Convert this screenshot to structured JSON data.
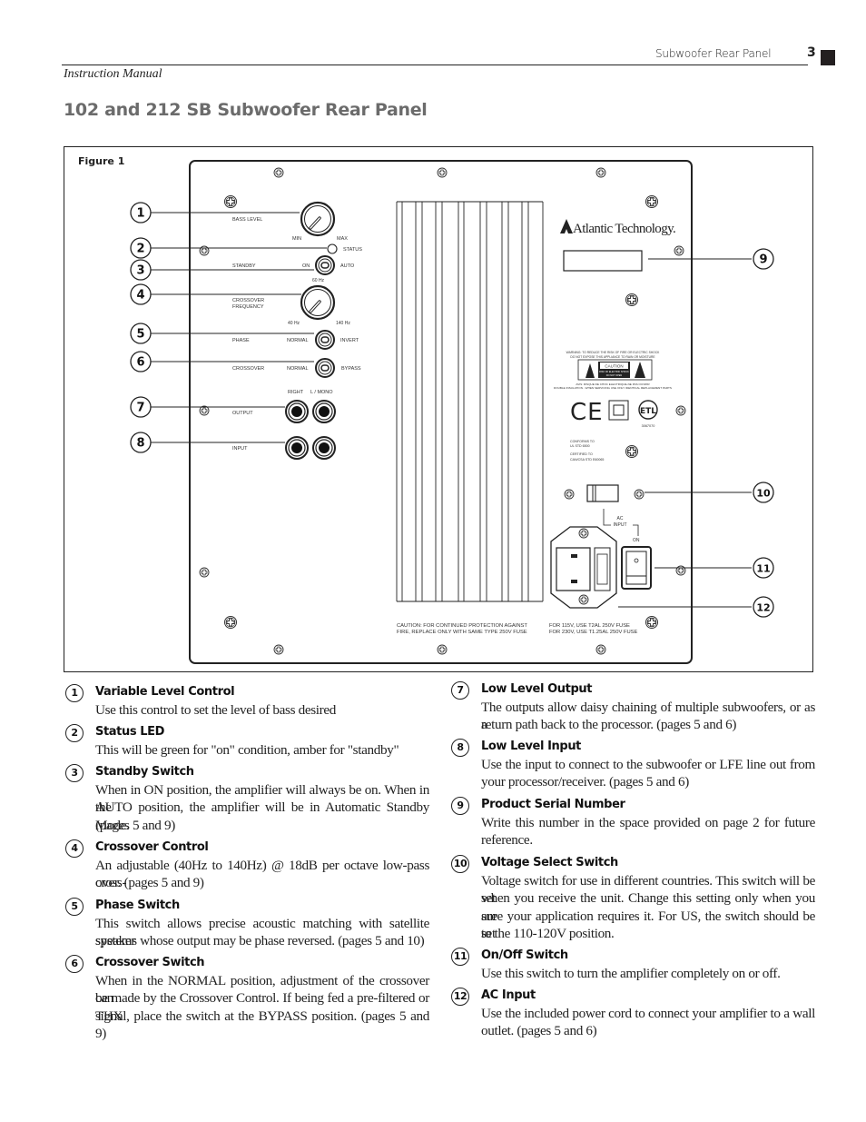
{
  "header": {
    "running_title": "Subwoofer Rear Panel",
    "page_number": "3",
    "manual_label": "Instruction Manual"
  },
  "page_title": "102 and 212 SB Subwoofer Rear Panel",
  "figure": {
    "label": "Figure 1",
    "brand": "Atlantic Technology.",
    "controls": {
      "bass_level": "BASS LEVEL",
      "min": "MIN",
      "max": "MAX",
      "status": "STATUS",
      "standby": "STANDBY",
      "on": "ON",
      "auto": "AUTO",
      "freq_60": "60 Hz",
      "crossover_frequency_1": "CROSSOVER",
      "crossover_frequency_2": "FREQUENCY",
      "freq_40": "40 Hz",
      "freq_140": "140 Hz",
      "phase": "PHASE",
      "normal": "NORMAL",
      "invert": "INVERT",
      "crossover": "CROSSOVER",
      "bypass": "BYPASS",
      "right": "RIGHT",
      "l_mono": "L / MONO",
      "output": "OUTPUT",
      "input": "INPUT"
    },
    "warning": {
      "line1": "WARNING: TO REDUCE THE RISK OF FIRE OR ELECTRIC SHOCK",
      "line2": "DO NOT EXPOSE THIS APPLIANCE TO RAIN OR MOISTURE",
      "caution": "CAUTION",
      "caution_sub1": "RISK OF ELECTRIC SHOCK",
      "caution_sub2": "DO NOT OPEN",
      "line3": "AVIS: RISQUE DE CHOC ELECTRIQUE-NE PAS OUVRIR",
      "line4": "DOUBLE INSULATION - WHEN SERVICING USE ONLY IDENTICAL REPLACEMENT PARTS"
    },
    "cert": {
      "ce": "CE",
      "etl_number": "3067070",
      "conforms1": "CONFORMS TO",
      "conforms2": "UL STD 6500",
      "certified1": "CERTIFIED TO",
      "certified2": "CAN/CSA STD E60065"
    },
    "ac": {
      "ac_input1": "AC",
      "ac_input2": "INPUT",
      "on": "ON"
    },
    "fuse_caution": {
      "line1": "CAUTION: FOR CONTINUED PROTECTION AGAINST",
      "line2": "FIRE, REPLACE ONLY WITH SAME TYPE 250V FUSE"
    },
    "fuse_rating": {
      "line1": "FOR 115V, USE T2AL 250V FUSE",
      "line2": "FOR 230V, USE T1.25AL 250V FUSE"
    },
    "callouts": [
      "1",
      "2",
      "3",
      "4",
      "5",
      "6",
      "7",
      "8",
      "9",
      "10",
      "11",
      "12"
    ]
  },
  "descriptions": [
    {
      "num": "1",
      "title": "Variable Level Control",
      "lines": [
        "Use this control to set the level of bass desired"
      ]
    },
    {
      "num": "2",
      "title": "Status LED",
      "lines": [
        "This will be green for \"on\" condition, amber for \"standby\""
      ]
    },
    {
      "num": "3",
      "title": "Standby Switch",
      "lines": [
        "When in ON position, the amplifier will always be on. When in the",
        "AUTO position, the amplifier will be in Automatic Standby Mode.",
        "(pages 5 and 9)"
      ]
    },
    {
      "num": "4",
      "title": "Crossover Control",
      "lines": [
        "An adjustable (40Hz to 140Hz) @ 18dB per octave low-pass cross-",
        "over. (pages 5 and 9)"
      ]
    },
    {
      "num": "5",
      "title": "Phase Switch",
      "lines": [
        "This switch allows precise acoustic matching with satellite speaker",
        "systems whose output may be phase reversed. (pages 5 and 10)"
      ]
    },
    {
      "num": "6",
      "title": "Crossover Switch",
      "lines": [
        "When in the NORMAL position, adjustment of the crossover can",
        "be made by the Crossover Control. If being fed a pre-filtered or THX",
        "signal, place the switch at the BYPASS position. (pages 5 and 9)"
      ]
    },
    {
      "num": "7",
      "title": "Low Level Output",
      "lines": [
        "The outputs allow daisy chaining of multiple subwoofers, or as a",
        "return path back to the processor. (pages 5 and 6)"
      ]
    },
    {
      "num": "8",
      "title": "Low Level Input",
      "lines": [
        "Use the input to connect to the subwoofer or LFE line out from",
        "your processor/receiver. (pages 5 and 6)"
      ]
    },
    {
      "num": "9",
      "title": "Product Serial Number",
      "lines": [
        "Write this number in the space provided on page 2 for future",
        "reference."
      ]
    },
    {
      "num": "10",
      "title": "Voltage Select Switch",
      "lines": [
        "Voltage switch for use in different countries. This switch will be set",
        "when you receive the unit. Change this setting only when you are",
        "sure your application requires it. For US, the switch should be set",
        "to the 110-120V position."
      ]
    },
    {
      "num": "11",
      "title": "On/Off Switch",
      "lines": [
        "Use this switch to turn the amplifier completely on or off."
      ]
    },
    {
      "num": "12",
      "title": "AC Input",
      "lines": [
        "Use the included power cord to connect your amplifier to a wall",
        "outlet. (pages 5 and 6)"
      ]
    }
  ]
}
